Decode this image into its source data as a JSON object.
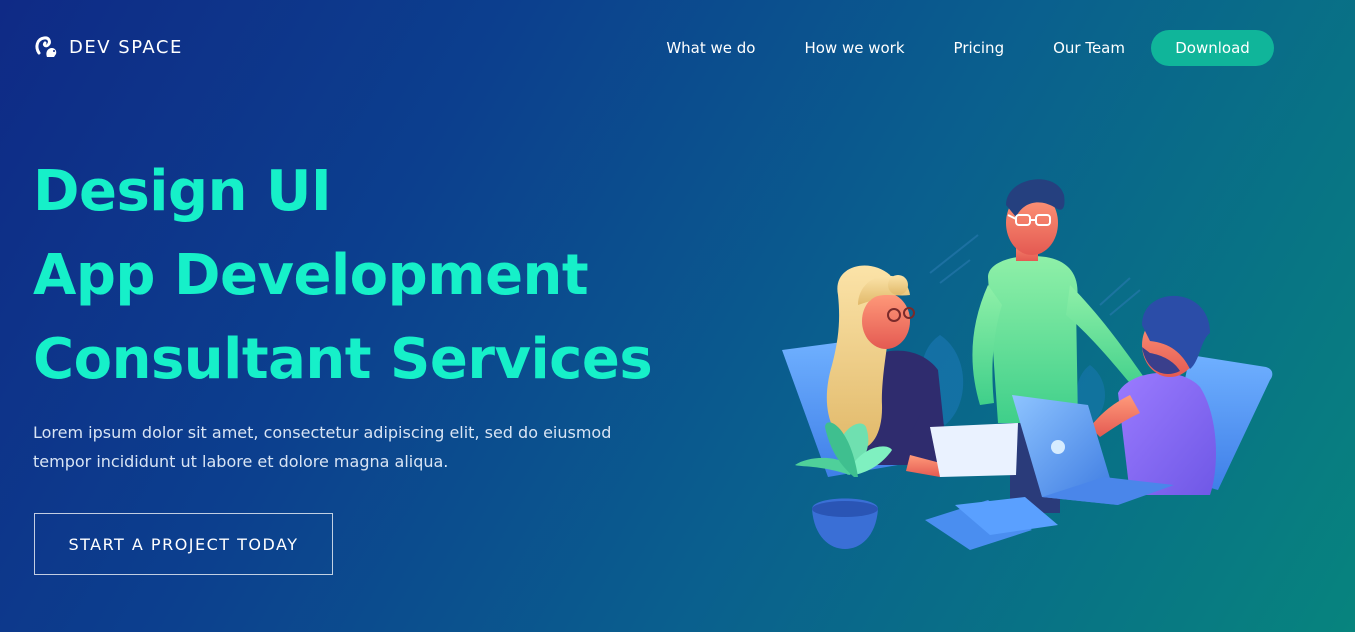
{
  "brand": {
    "name": "DEV SPACE",
    "logo_icon": "squirrel-logo-icon"
  },
  "nav": {
    "links": [
      "What we do",
      "How we work",
      "Pricing",
      "Our Team"
    ],
    "download_label": "Download",
    "accent_color": "#10b59a"
  },
  "hero": {
    "title_lines": [
      "Design UI",
      "App Development",
      "Consultant Services"
    ],
    "description_line1": "Lorem ipsum dolor sit amet, consectetur adipiscing elit, sed do eiusmod",
    "description_line2": "tempor incididunt ut labore et dolore magna aliqua.",
    "cta_label": "START A PROJECT TODAY",
    "title_color": "#16f0c9"
  },
  "illustration": {
    "name": "team-meeting-illustration"
  }
}
